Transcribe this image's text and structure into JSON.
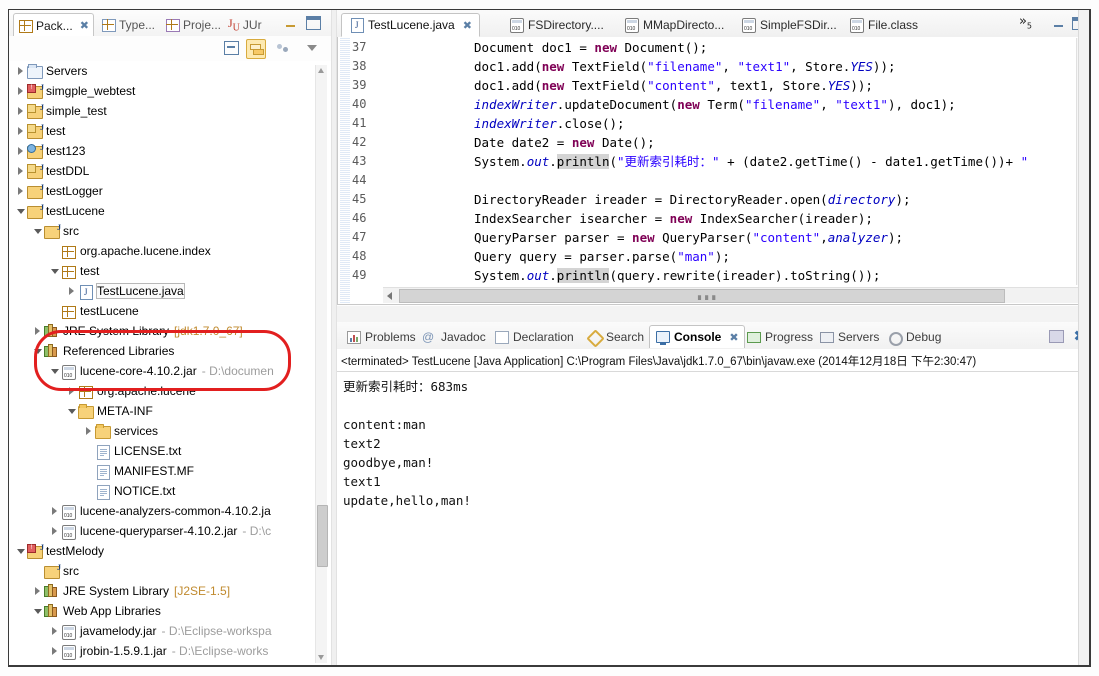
{
  "explorer": {
    "tabs": [
      {
        "label": "Pack...",
        "icon": "package-explorer-icon",
        "active": true,
        "closable": true
      },
      {
        "label": "Type...",
        "icon": "type-hierarchy-icon",
        "active": false,
        "closable": false
      },
      {
        "label": "Proje...",
        "icon": "project-explorer-icon",
        "active": false,
        "closable": false
      },
      {
        "label": "JUr",
        "icon": "junit-icon",
        "active": false,
        "closable": false
      }
    ],
    "toolbar": [
      {
        "name": "collapse-all-button",
        "icon": "collapse-all-icon",
        "pressed": false
      },
      {
        "name": "link-with-editor-button",
        "icon": "link-editor-icon",
        "pressed": true
      },
      {
        "name": "focus-on-active-task-button",
        "icon": "focus-task-icon",
        "pressed": false
      },
      {
        "name": "view-menu-button",
        "icon": "chevron-down-icon",
        "pressed": false
      }
    ],
    "minimize_label": "Minimize",
    "maximize_label": "Maximize",
    "tree": [
      {
        "indent": 0,
        "twisty": "closed",
        "icon": "servers-icon",
        "label": "Servers",
        "sub": ""
      },
      {
        "indent": 0,
        "twisty": "closed",
        "icon": "java-project-error-icon",
        "label": "simgple_webtest",
        "sub": ""
      },
      {
        "indent": 0,
        "twisty": "closed",
        "icon": "java-project-warning-icon",
        "label": "simple_test",
        "sub": ""
      },
      {
        "indent": 0,
        "twisty": "closed",
        "icon": "java-project-warning-icon",
        "label": "test",
        "sub": ""
      },
      {
        "indent": 0,
        "twisty": "closed",
        "icon": "java-project-web-icon",
        "label": "test123",
        "sub": ""
      },
      {
        "indent": 0,
        "twisty": "closed",
        "icon": "java-project-warning-icon",
        "label": "testDDL",
        "sub": ""
      },
      {
        "indent": 0,
        "twisty": "closed",
        "icon": "java-project-icon",
        "label": "testLogger",
        "sub": ""
      },
      {
        "indent": 0,
        "twisty": "open",
        "icon": "java-project-icon",
        "label": "testLucene",
        "sub": ""
      },
      {
        "indent": 1,
        "twisty": "open",
        "icon": "source-folder-icon",
        "label": "src",
        "sub": ""
      },
      {
        "indent": 2,
        "twisty": "none",
        "icon": "package-icon",
        "label": "org.apache.lucene.index",
        "sub": ""
      },
      {
        "indent": 2,
        "twisty": "open",
        "icon": "package-icon",
        "label": "test",
        "sub": ""
      },
      {
        "indent": 3,
        "twisty": "closed",
        "icon": "java-file-icon",
        "label": "TestLucene.java",
        "sub": "",
        "selected": true
      },
      {
        "indent": 2,
        "twisty": "none",
        "icon": "package-icon",
        "label": "testLucene",
        "sub": ""
      },
      {
        "indent": 1,
        "twisty": "closed",
        "icon": "library-icon",
        "label": "JRE System Library",
        "sub": "[jdk1.7.0_67]"
      },
      {
        "indent": 1,
        "twisty": "open",
        "icon": "library-icon",
        "label": "Referenced Libraries",
        "sub": ""
      },
      {
        "indent": 2,
        "twisty": "open",
        "icon": "jar-icon",
        "label": "lucene-core-4.10.2.jar",
        "sub": "- D:\\documen"
      },
      {
        "indent": 3,
        "twisty": "closed",
        "icon": "package-icon",
        "label": "org.apache.lucene",
        "sub": ""
      },
      {
        "indent": 3,
        "twisty": "open",
        "icon": "folder-icon",
        "label": "META-INF",
        "sub": ""
      },
      {
        "indent": 4,
        "twisty": "closed",
        "icon": "folder-icon",
        "label": "services",
        "sub": ""
      },
      {
        "indent": 4,
        "twisty": "none",
        "icon": "text-file-icon",
        "label": "LICENSE.txt",
        "sub": ""
      },
      {
        "indent": 4,
        "twisty": "none",
        "icon": "text-file-icon",
        "label": "MANIFEST.MF",
        "sub": ""
      },
      {
        "indent": 4,
        "twisty": "none",
        "icon": "text-file-icon",
        "label": "NOTICE.txt",
        "sub": ""
      },
      {
        "indent": 2,
        "twisty": "closed",
        "icon": "jar-icon",
        "label": "lucene-analyzers-common-4.10.2.ja",
        "sub": ""
      },
      {
        "indent": 2,
        "twisty": "closed",
        "icon": "jar-icon",
        "label": "lucene-queryparser-4.10.2.jar",
        "sub": "- D:\\c"
      },
      {
        "indent": 0,
        "twisty": "open",
        "icon": "java-project-error-icon",
        "label": "testMelody",
        "sub": ""
      },
      {
        "indent": 1,
        "twisty": "none",
        "icon": "source-folder-icon",
        "label": "src",
        "sub": ""
      },
      {
        "indent": 1,
        "twisty": "closed",
        "icon": "library-icon",
        "label": "JRE System Library",
        "sub": "[J2SE-1.5]"
      },
      {
        "indent": 1,
        "twisty": "open",
        "icon": "library-icon",
        "label": "Web App Libraries",
        "sub": ""
      },
      {
        "indent": 2,
        "twisty": "closed",
        "icon": "jar-icon",
        "label": "javamelody.jar",
        "sub": "- D:\\Eclipse-workspa"
      },
      {
        "indent": 2,
        "twisty": "closed",
        "icon": "jar-icon",
        "label": "jrobin-1.5.9.1.jar",
        "sub": "- D:\\Eclipse-works"
      }
    ],
    "annotation": {
      "name": "red-highlight-ellipse",
      "color": "#e21f1f"
    }
  },
  "editor": {
    "tabs": [
      {
        "label": "TestLucene.java",
        "icon": "java-file-icon",
        "active": true,
        "closable": true
      },
      {
        "label": "FSDirectory....",
        "icon": "class-file-icon",
        "active": false,
        "closable": false
      },
      {
        "label": "MMapDirecto...",
        "icon": "class-file-icon",
        "active": false,
        "closable": false
      },
      {
        "label": "SimpleFSDir...",
        "icon": "class-file-icon",
        "active": false,
        "closable": false
      },
      {
        "label": "File.class",
        "icon": "class-file-icon",
        "active": false,
        "closable": false
      }
    ],
    "overflow_label": "»",
    "overflow_count": "5",
    "minimize_label": "Minimize",
    "maximize_label": "Maximize",
    "lines": [
      {
        "num": "37",
        "text": "Document doc1 = new Document();"
      },
      {
        "num": "38",
        "text": "doc1.add(new TextField(\"filename\", \"text1\", Store.YES));"
      },
      {
        "num": "39",
        "text": "doc1.add(new TextField(\"content\", text1, Store.YES));"
      },
      {
        "num": "40",
        "text": "indexWriter.updateDocument(new Term(\"filename\", \"text1\"), doc1);"
      },
      {
        "num": "41",
        "text": "indexWriter.close();"
      },
      {
        "num": "42",
        "text": "Date date2 = new Date();"
      },
      {
        "num": "43",
        "text": "System.out.println(\"更新索引耗时：\" + (date2.getTime() - date1.getTime())+ \""
      },
      {
        "num": "44",
        "text": ""
      },
      {
        "num": "45",
        "text": "DirectoryReader ireader = DirectoryReader.open(directory);"
      },
      {
        "num": "46",
        "text": "IndexSearcher isearcher = new IndexSearcher(ireader);"
      },
      {
        "num": "47",
        "text": "QueryParser parser = new QueryParser(\"content\",analyzer);"
      },
      {
        "num": "48",
        "text": "Query query = parser.parse(\"man\");"
      },
      {
        "num": "49",
        "text": "System.out.println(query.rewrite(ireader).toString());"
      }
    ]
  },
  "console": {
    "tabs": [
      {
        "label": "Problems",
        "icon": "problems-icon",
        "active": false
      },
      {
        "label": "Javadoc",
        "icon": "javadoc-icon",
        "active": false
      },
      {
        "label": "Declaration",
        "icon": "declaration-icon",
        "active": false
      },
      {
        "label": "Search",
        "icon": "search-icon",
        "active": false
      },
      {
        "label": "Console",
        "icon": "console-icon",
        "active": true
      },
      {
        "label": "Progress",
        "icon": "progress-icon",
        "active": false
      },
      {
        "label": "Servers",
        "icon": "servers-icon",
        "active": false
      },
      {
        "label": "Debug",
        "icon": "debug-icon",
        "active": false
      }
    ],
    "minimize_label": "Minimize",
    "close_label": "Close",
    "header": "<terminated> TestLucene [Java Application] C:\\Program Files\\Java\\jdk1.7.0_67\\bin\\javaw.exe (2014年12月18日 下午2:30:47)",
    "output": [
      "更新索引耗时：683ms",
      "",
      "content:man",
      "text2",
      "goodbye,man!",
      "text1",
      "update,hello,man!"
    ]
  }
}
